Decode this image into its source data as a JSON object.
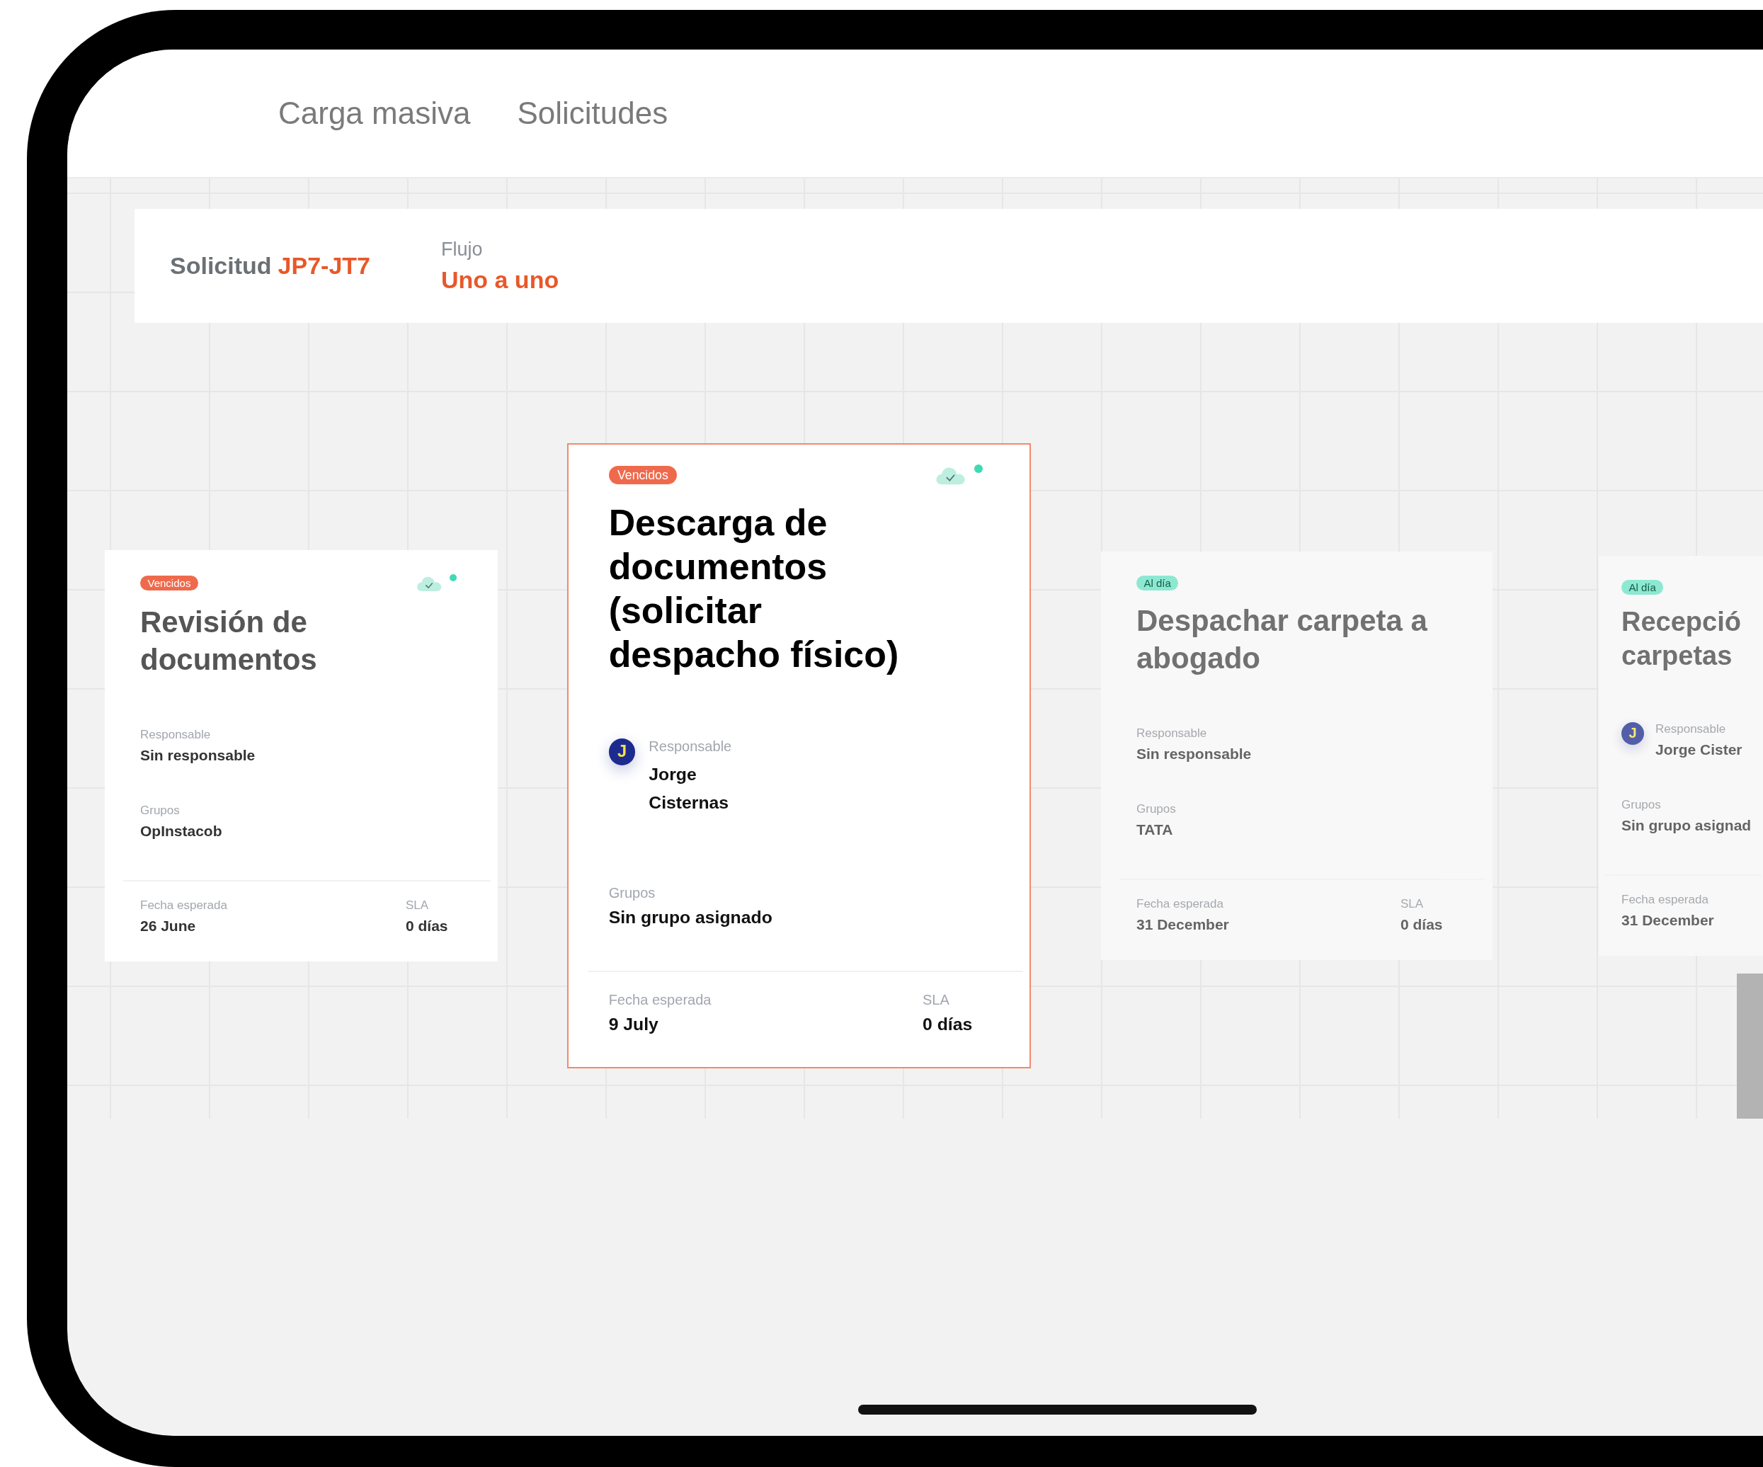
{
  "nav": [
    {
      "label": "Carga masiva"
    },
    {
      "label": "Solicitudes"
    }
  ],
  "request": {
    "label": "Solicitud",
    "code": "JP7-JT7",
    "flow_label": "Flujo",
    "flow": "Uno a uno"
  },
  "cards": [
    {
      "status": "Vencidos",
      "color": "#ef6a4c",
      "title": "Revisión de documentos",
      "selected": false,
      "dimmed": false,
      "synced": true,
      "responsible_label": "Responsable",
      "responsible": "Sin responsable",
      "groups_label": "Grupos",
      "groups": "OpInstacob",
      "date_label": "Fecha esperada",
      "date": "26 June",
      "sla_label": "SLA",
      "sla": "0 días"
    },
    {
      "status": "Vencidos",
      "color": "#ef6a4c",
      "title": "Descarga de documentos (solicitar despacho físico)",
      "selected": true,
      "dimmed": false,
      "synced": true,
      "avatar": "J",
      "responsible_label": "Responsable",
      "responsible": "Jorge Cisternas",
      "groups_label": "Grupos",
      "groups": "Sin grupo asignado",
      "date_label": "Fecha esperada",
      "date": "9 July",
      "sla_label": "SLA",
      "sla": "0 días"
    },
    {
      "status": "Al día",
      "color": "#8de8d2",
      "title": "Despachar carpeta a abogado",
      "selected": false,
      "dimmed": true,
      "synced": false,
      "responsible_label": "Responsable",
      "responsible": "Sin responsable",
      "groups_label": "Grupos",
      "groups": "TATA",
      "date_label": "Fecha esperada",
      "date": "31 December",
      "sla_label": "SLA",
      "sla": "0 días"
    },
    {
      "status": "Al día",
      "color": "#8de8d2",
      "title": "Recepció carpetas",
      "selected": false,
      "dimmed": true,
      "synced": false,
      "avatar": "J",
      "responsible_label": "Responsable",
      "responsible": "Jorge Cister",
      "groups_label": "Grupos",
      "groups": "Sin grupo asignad",
      "date_label": "Fecha esperada",
      "date": "31 December"
    }
  ]
}
